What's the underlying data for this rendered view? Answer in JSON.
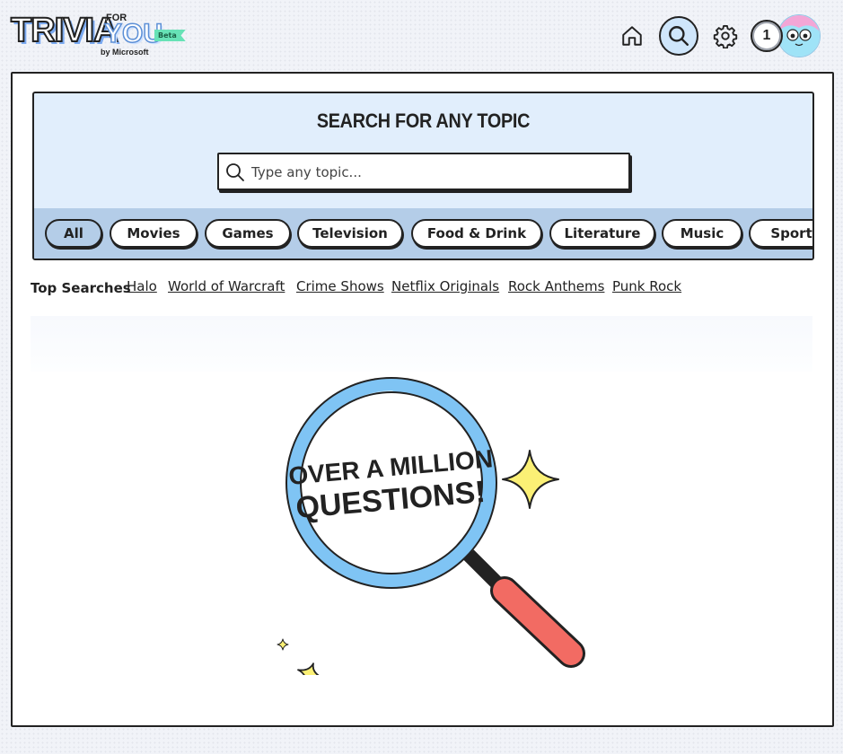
{
  "header": {
    "logo": {
      "main": "TRIVIA",
      "for": "FOR",
      "you": "YOU",
      "badge": "Beta",
      "byline": "by Microsoft"
    },
    "nav": {
      "home_icon": "home-icon",
      "search_icon": "search-icon",
      "settings_icon": "gear-icon"
    },
    "coins": "1",
    "avatar": "avatar-character"
  },
  "search": {
    "title": "SEARCH FOR ANY TOPIC",
    "placeholder": "Type any topic..."
  },
  "categories": [
    "All",
    "Movies",
    "Games",
    "Television",
    "Food & Drink",
    "Literature",
    "Music",
    "Sports"
  ],
  "active_category": "All",
  "top_searches": {
    "label": "Top Searches",
    "items": [
      "Halo",
      "World of Warcraft",
      "Crime Shows",
      "Netflix Originals",
      "Rock Anthems",
      "Punk Rock"
    ]
  },
  "hero": {
    "line1": "OVER A MILLION",
    "line2": "QUESTIONS!"
  },
  "colors": {
    "panel_bg": "#e1eefc",
    "strip_bg": "#b4cde8",
    "lens_ring": "#7fc4f4",
    "handle": "#f26b63",
    "sparkle": "#fbf075"
  }
}
